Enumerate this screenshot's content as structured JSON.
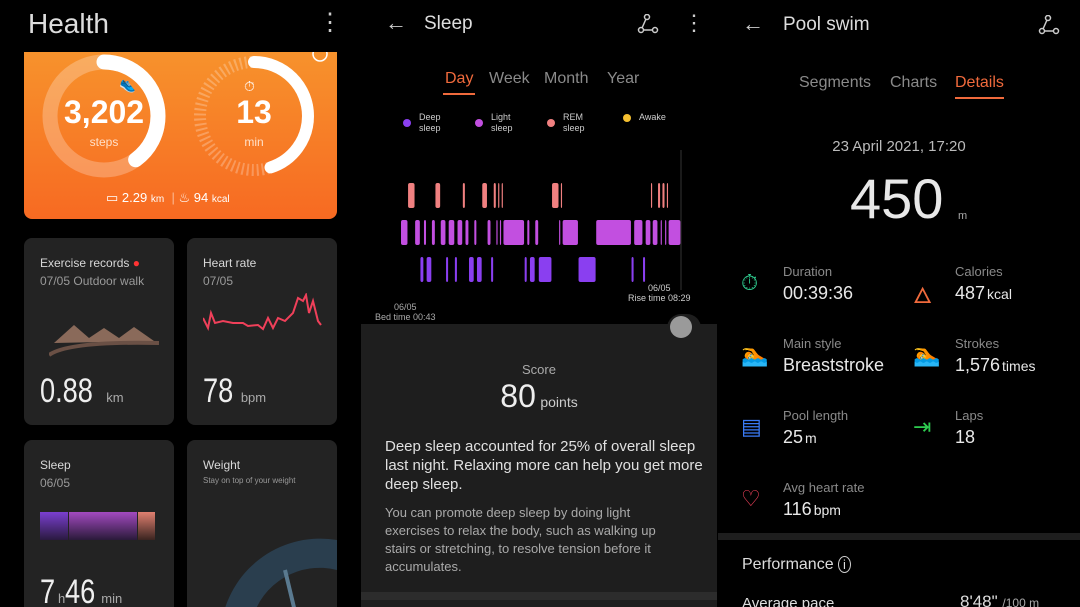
{
  "health": {
    "title": "Health",
    "steps": "3,202",
    "steps_unit": "steps",
    "minutes": "13",
    "minutes_unit": "min",
    "distance": "2.29",
    "distance_unit": "km",
    "calories": "94",
    "calories_unit": "kcal",
    "steps_progress": 0.4,
    "minutes_progress": 0.45,
    "cards": {
      "exercise": {
        "title": "Exercise records",
        "subtitle": "07/05 Outdoor walk",
        "value": "0.88",
        "unit": "km"
      },
      "heart": {
        "title": "Heart rate",
        "subtitle": "07/05",
        "value": "78",
        "unit": "bpm"
      },
      "sleep": {
        "title": "Sleep",
        "subtitle": "06/05",
        "hours": "7",
        "h": "h",
        "mins": "46",
        "min": "min"
      },
      "weight": {
        "title": "Weight",
        "subtitle": "Stay on top of your weight"
      }
    }
  },
  "sleep": {
    "title": "Sleep",
    "tabs": [
      "Day",
      "Week",
      "Month",
      "Year"
    ],
    "active_tab": "Day",
    "legend": [
      {
        "label1": "Deep",
        "label2": "sleep",
        "color": "#8a3ff0"
      },
      {
        "label1": "Light",
        "label2": "sleep",
        "color": "#c24fe0"
      },
      {
        "label1": "REM",
        "label2": "sleep",
        "color": "#f08080"
      },
      {
        "label1": "Awake",
        "label2": "",
        "color": "#f5c030"
      }
    ],
    "bed_date": "06/05",
    "bed_time": "Bed time 00:43",
    "rise_date": "06/05",
    "rise_time": "Rise time 08:29",
    "score_label": "Score",
    "score": "80",
    "score_unit": "points",
    "summary": "Deep sleep accounted for 25% of overall sleep last night. Relaxing more can help you get more deep sleep.",
    "advice": "You can promote deep sleep by doing light exercises to relax the body, such as walking up stairs or stretching, to resolve tension before it accumulates.",
    "chart_data": {
      "type": "timeline",
      "x_range": [
        "00:43",
        "08:29"
      ],
      "levels": [
        "REM sleep",
        "Light sleep",
        "Deep sleep"
      ],
      "segments": [
        [
          "light",
          8
        ],
        [
          "rem",
          8
        ],
        [
          "light",
          6
        ],
        [
          "deep",
          4
        ],
        [
          "light",
          3
        ],
        [
          "deep",
          6
        ],
        [
          "light",
          4
        ],
        [
          "rem",
          6
        ],
        [
          "light",
          6
        ],
        [
          "deep",
          3
        ],
        [
          "light",
          7
        ],
        [
          "deep",
          3
        ],
        [
          "light",
          6
        ],
        [
          "rem",
          3
        ],
        [
          "light",
          4
        ],
        [
          "deep",
          6
        ],
        [
          "light",
          3
        ],
        [
          "deep",
          6
        ],
        [
          "rem",
          6
        ],
        [
          "light",
          4
        ],
        [
          "deep",
          3
        ],
        [
          "rem",
          3
        ],
        [
          "light",
          2
        ],
        [
          "rem",
          2
        ],
        [
          "light",
          2
        ],
        [
          "rem",
          2
        ],
        [
          "light",
          24
        ],
        [
          "deep",
          3
        ],
        [
          "light",
          3
        ],
        [
          "deep",
          6
        ],
        [
          "light",
          4
        ],
        [
          "deep",
          15
        ],
        [
          "rem",
          8
        ],
        [
          "light",
          2
        ],
        [
          "rem",
          2
        ],
        [
          "light",
          18
        ],
        [
          "deep",
          20
        ],
        [
          "light",
          40
        ],
        [
          "deep",
          3
        ],
        [
          "light",
          10
        ],
        [
          "deep",
          3
        ],
        [
          "light",
          6
        ],
        [
          "rem",
          2
        ],
        [
          "light",
          6
        ],
        [
          "rem",
          3
        ],
        [
          "light",
          2
        ],
        [
          "rem",
          3
        ],
        [
          "light",
          2
        ],
        [
          "rem",
          2
        ],
        [
          "light",
          14
        ]
      ]
    }
  },
  "swim": {
    "title": "Pool swim",
    "tabs": [
      "Segments",
      "Charts",
      "Details"
    ],
    "active_tab": "Details",
    "date": "23 April 2021, 17:20",
    "distance": "450",
    "distance_unit": "m",
    "stats": [
      {
        "label": "Duration",
        "value": "00:39:36",
        "unit": "",
        "icon": "stopwatch-icon",
        "color": "#2ecc8f"
      },
      {
        "label": "Calories",
        "value": "487",
        "unit": "kcal",
        "icon": "flame-icon",
        "color": "#f06a3c"
      },
      {
        "label": "Main style",
        "value": "Breaststroke",
        "unit": "",
        "icon": "swimmer-icon",
        "color": "#3aa0f5"
      },
      {
        "label": "Strokes",
        "value": "1,576",
        "unit": "times",
        "icon": "stroke-count-icon",
        "color": "#f5a030"
      },
      {
        "label": "Pool length",
        "value": "25",
        "unit": "m",
        "icon": "pool-length-icon",
        "color": "#3a7af5"
      },
      {
        "label": "Laps",
        "value": "18",
        "unit": "",
        "icon": "laps-icon",
        "color": "#2ecc50"
      },
      {
        "label": "Avg heart rate",
        "value": "116",
        "unit": "bpm",
        "icon": "heart-rate-icon",
        "color": "#f0405a"
      }
    ],
    "performance": "Performance",
    "pace_label": "Average pace",
    "pace": "8'48\"",
    "pace_unit": "/100 m"
  },
  "colors": {
    "orange": "#f7782a",
    "accent": "#f06a3c"
  }
}
